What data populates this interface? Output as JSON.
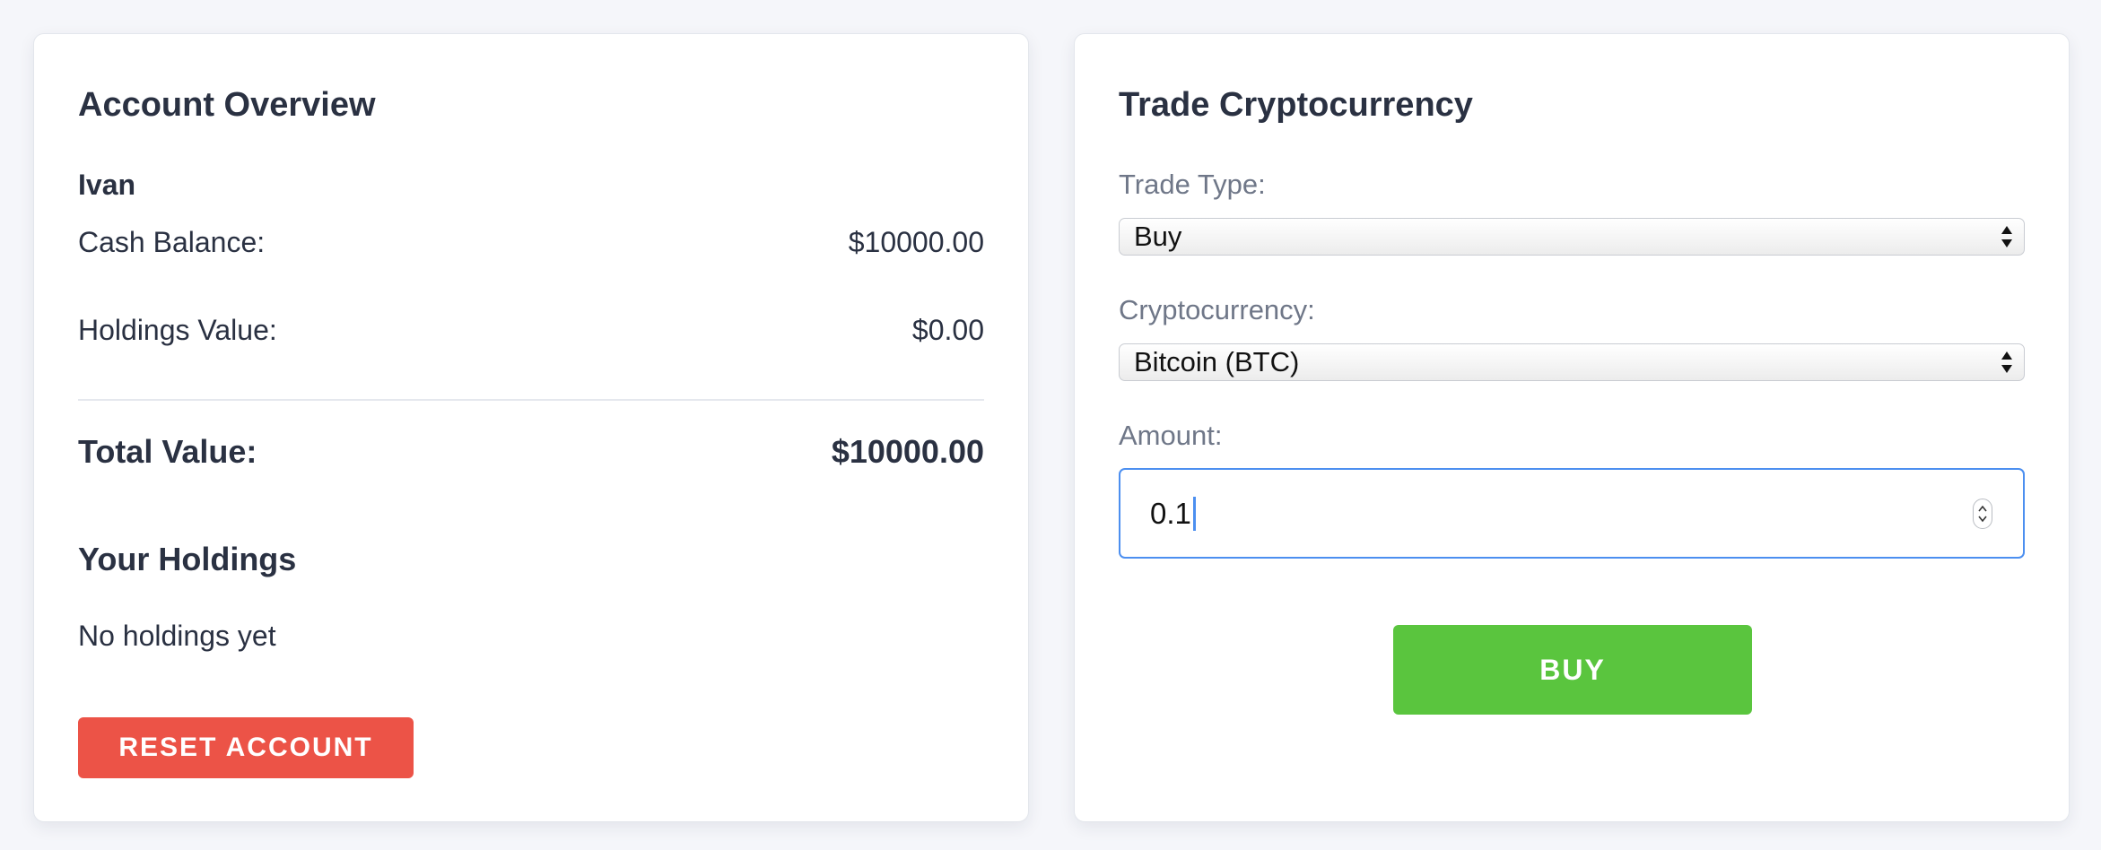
{
  "account": {
    "title": "Account Overview",
    "user_name": "Ivan",
    "cash_label": "Cash Balance:",
    "cash_value": "$10000.00",
    "holdings_label": "Holdings Value:",
    "holdings_value": "$0.00",
    "total_label": "Total Value:",
    "total_value": "$10000.00",
    "holdings_title": "Your Holdings",
    "holdings_empty": "No holdings yet",
    "reset_label": "RESET ACCOUNT"
  },
  "trade": {
    "title": "Trade Cryptocurrency",
    "type_label": "Trade Type:",
    "type_value": "Buy",
    "crypto_label": "Cryptocurrency:",
    "crypto_value": "Bitcoin (BTC)",
    "amount_label": "Amount:",
    "amount_value": "0.1",
    "submit_label": "BUY"
  },
  "colors": {
    "page_background": "#f5f6fa",
    "reset_button": "#ec5347",
    "buy_button": "#5ac53e",
    "focus_border": "#4c8ff0",
    "label_gray": "#6f7788",
    "text_dark": "#2a3142"
  },
  "icons": {
    "select_arrows": "up-down-arrows-icon",
    "number_stepper": "stepper-icon"
  }
}
